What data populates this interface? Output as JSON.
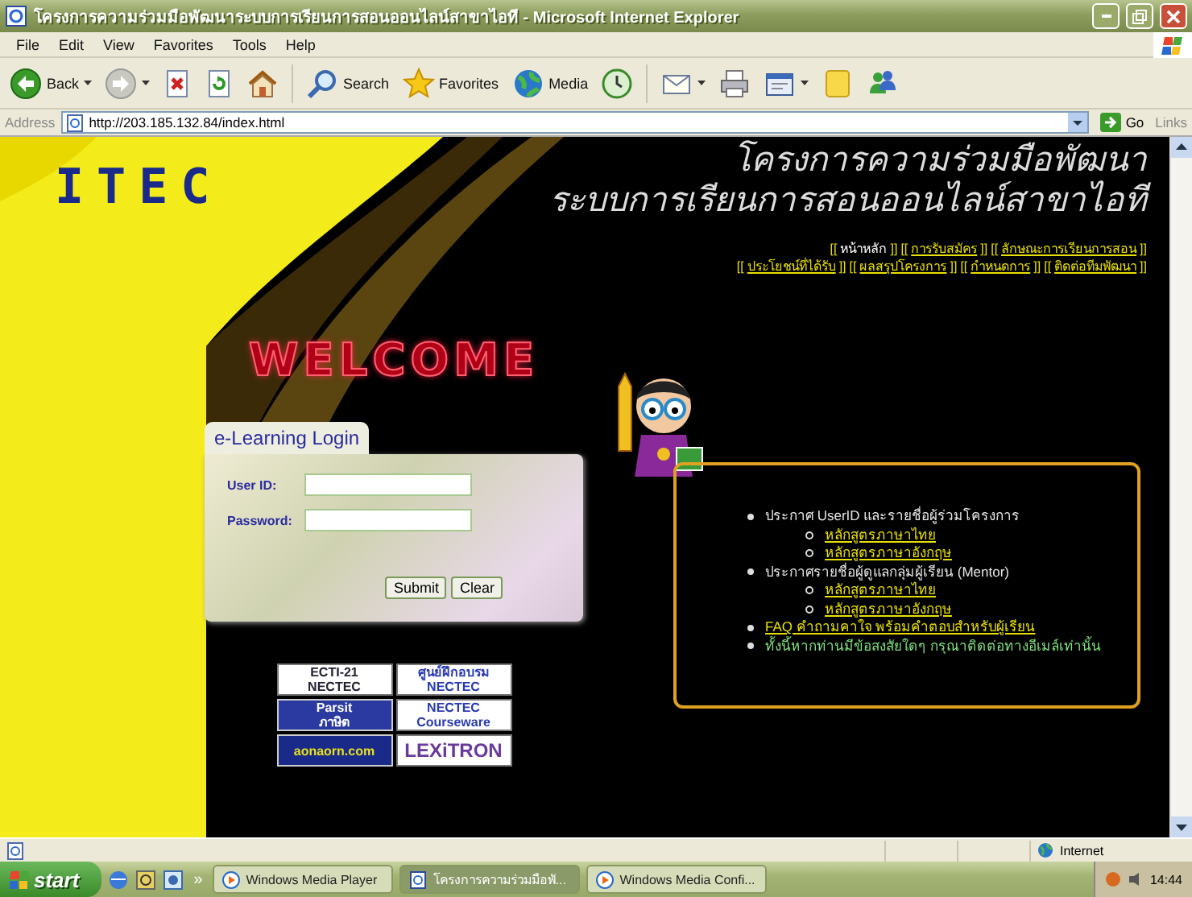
{
  "window": {
    "title": "โครงการความร่วมมือพัฒนาระบบการเรียนการสอนออนไลน์สาขาไอที - Microsoft Internet Explorer"
  },
  "menu": [
    "File",
    "Edit",
    "View",
    "Favorites",
    "Tools",
    "Help"
  ],
  "toolbar": [
    {
      "kind": "back",
      "label": "Back"
    },
    {
      "kind": "forward"
    },
    {
      "kind": "stop"
    },
    {
      "kind": "refresh"
    },
    {
      "kind": "home"
    },
    {
      "kind": "search",
      "label": "Search"
    },
    {
      "kind": "favorites",
      "label": "Favorites"
    },
    {
      "kind": "media",
      "label": "Media"
    },
    {
      "kind": "history"
    },
    {
      "kind": "mail"
    },
    {
      "kind": "print"
    },
    {
      "kind": "edit"
    },
    {
      "kind": "notes"
    },
    {
      "kind": "messenger"
    }
  ],
  "address": {
    "label": "Address",
    "url": "http://203.185.132.84/index.html",
    "go": "Go",
    "links": "Links"
  },
  "page": {
    "logo": "ITEC",
    "heading": [
      "โครงการความร่วมมือพัฒนา",
      "ระบบการเรียนการสอนออนไลน์สาขาไอที"
    ],
    "nav": {
      "open": "[[",
      "close": "]]",
      "rows": [
        [
          {
            "label": "หน้าหลัก",
            "selected": true
          },
          {
            "label": "การรับสมัคร",
            "selected": false
          },
          {
            "label": "ลักษณะการเรียนการสอน",
            "selected": false
          }
        ],
        [
          {
            "label": "ประโยชน์ที่ได้รับ",
            "selected": false
          },
          {
            "label": "ผลสรุปโครงการ",
            "selected": false
          },
          {
            "label": "กำหนดการ",
            "selected": false
          },
          {
            "label": "ติดต่อทีมพัฒนา",
            "selected": false
          }
        ]
      ]
    },
    "welcome": "WELCOME",
    "login": {
      "title": "e-Learning Login",
      "fields": [
        {
          "label": "User ID:"
        },
        {
          "label": "Password:"
        }
      ],
      "buttons": [
        "Submit",
        "Clear"
      ]
    },
    "logos": [
      {
        "kind": "ecti",
        "lines": [
          "ECTI-21",
          "NECTEC"
        ]
      },
      {
        "kind": "training",
        "lines": [
          "ศูนย์ฝึกอบรม",
          "NECTEC"
        ]
      },
      {
        "kind": "parsit",
        "lines": [
          "Parsit",
          "ภาษิต"
        ]
      },
      {
        "kind": "courseware",
        "lines": [
          "NECTEC",
          "Courseware"
        ]
      },
      {
        "kind": "aonaorn",
        "lines": [
          "aonaorn.com"
        ]
      },
      {
        "kind": "lexitron",
        "lines": [
          "LEXiTRON"
        ]
      }
    ],
    "announcements": [
      {
        "kind": "text",
        "text": "ประกาศ UserID และรายชื่อผู้ร่วมโครงการ",
        "children": [
          {
            "kind": "link",
            "text": "หลักสูตรภาษาไทย"
          },
          {
            "kind": "link",
            "text": "หลักสูตรภาษาอังกฤษ"
          }
        ]
      },
      {
        "kind": "text",
        "text": "ประกาศรายชื่อผู้ดูแลกลุ่มผู้เรียน (Mentor)",
        "children": [
          {
            "kind": "link",
            "text": "หลักสูตรภาษาไทย"
          },
          {
            "kind": "link",
            "text": "หลักสูตรภาษาอังกฤษ"
          }
        ]
      },
      {
        "kind": "link",
        "text": "FAQ คำถามคาใจ พร้อมคำตอบสำหรับผู้เรียน"
      },
      {
        "kind": "note",
        "text": "ทั้งนี้หากท่านมีข้อสงสัยใดๆ กรุณาติดต่อทางอีเมล์เท่านั้น"
      }
    ]
  },
  "status_bar": {
    "zone": "Internet"
  },
  "taskbar": {
    "start": "start",
    "more": "»",
    "tasks": [
      {
        "kind": "media",
        "label": "Windows Media Player",
        "selected": false
      },
      {
        "kind": "browser",
        "label": "โครงการความร่วมมือพั...",
        "selected": true
      },
      {
        "kind": "media",
        "label": "Windows Media Confi...",
        "selected": false
      }
    ],
    "clock": "14:44"
  }
}
